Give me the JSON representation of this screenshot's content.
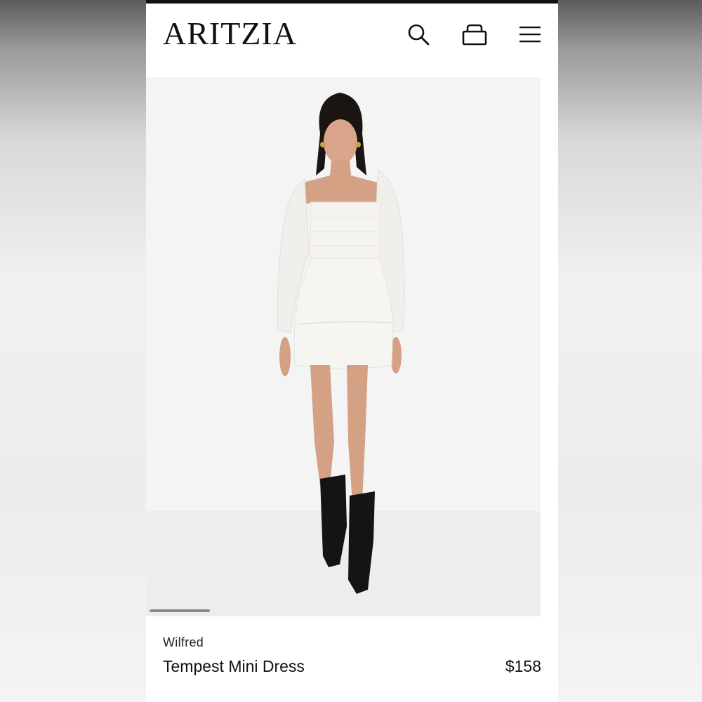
{
  "header": {
    "logo": "ARITZIA",
    "icons": [
      "search-icon",
      "shopping-bag-icon",
      "hamburger-menu-icon"
    ]
  },
  "product": {
    "brand": "Wilfred",
    "name": "Tempest Mini Dress",
    "price": "$158"
  },
  "colors": {
    "text": "#111111",
    "background": "#ffffff",
    "hero_background": "#f4f4f4"
  }
}
